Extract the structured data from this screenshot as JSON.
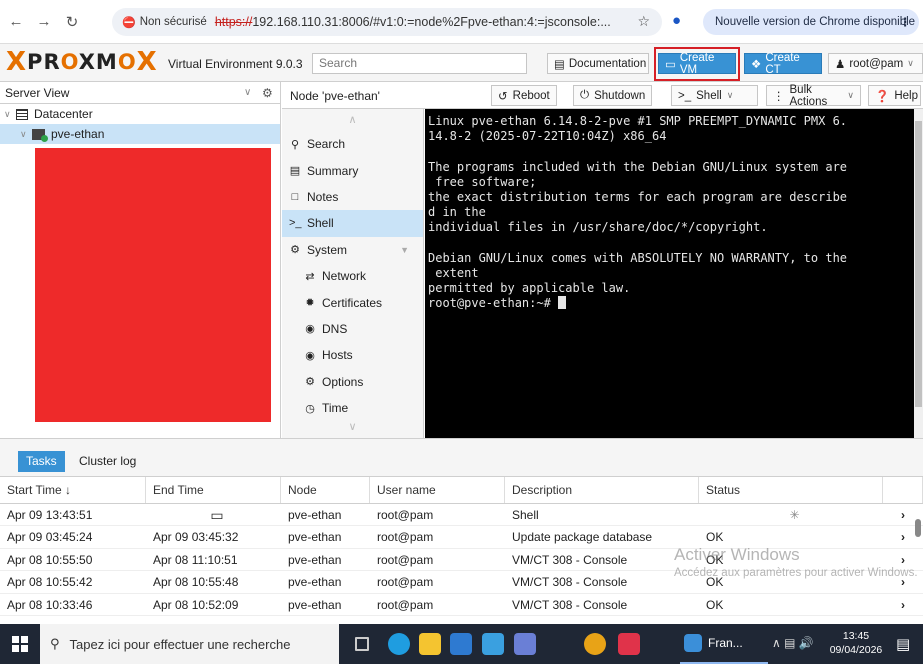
{
  "browser": {
    "security_label": "Non sécurisé",
    "url_scheme": "https://",
    "url_rest": "192.168.110.31:8006/#v1:0:=node%2Fpve-ethan:4:=jsconsole:...",
    "update_label": "Nouvelle version de Chrome disponible"
  },
  "header": {
    "version": "Virtual Environment 9.0.3",
    "search_placeholder": "Search",
    "documentation": "Documentation",
    "create_vm": "Create VM",
    "create_ct": "Create CT",
    "user": "root@pam"
  },
  "tree": {
    "view": "Server View",
    "datacenter": "Datacenter",
    "node": "pve-ethan"
  },
  "node_panel": {
    "title": "Node 'pve-ethan'",
    "reboot": "Reboot",
    "shutdown": "Shutdown",
    "shell": "Shell",
    "bulk": "Bulk Actions",
    "help": "Help",
    "menu": {
      "search": "Search",
      "summary": "Summary",
      "notes": "Notes",
      "shell": "Shell",
      "system": "System",
      "network": "Network",
      "certificates": "Certificates",
      "dns": "DNS",
      "hosts": "Hosts",
      "options": "Options",
      "time": "Time"
    }
  },
  "terminal": {
    "text": "Linux pve-ethan 6.14.8-2-pve #1 SMP PREEMPT_DYNAMIC PMX 6.\n14.8-2 (2025-07-22T10:04Z) x86_64\n\nThe programs included with the Debian GNU/Linux system are\n free software;\nthe exact distribution terms for each program are describe\nd in the\nindividual files in /usr/share/doc/*/copyright.\n\nDebian GNU/Linux comes with ABSOLUTELY NO WARRANTY, to the\n extent\npermitted by applicable law.\nroot@pve-ethan:~# "
  },
  "tasks": {
    "tab_tasks": "Tasks",
    "tab_cluster": "Cluster log",
    "columns": [
      "Start Time ↓",
      "End Time",
      "Node",
      "User name",
      "Description",
      "Status"
    ],
    "rows": [
      {
        "start": "Apr 09 13:43:51",
        "end": "",
        "node": "pve-ethan",
        "user": "root@pam",
        "desc": "Shell",
        "status": ""
      },
      {
        "start": "Apr 09 03:45:24",
        "end": "Apr 09 03:45:32",
        "node": "pve-ethan",
        "user": "root@pam",
        "desc": "Update package database",
        "status": "OK"
      },
      {
        "start": "Apr 08 10:55:50",
        "end": "Apr 08 11:10:51",
        "node": "pve-ethan",
        "user": "root@pam",
        "desc": "VM/CT 308 - Console",
        "status": "OK"
      },
      {
        "start": "Apr 08 10:55:42",
        "end": "Apr 08 10:55:48",
        "node": "pve-ethan",
        "user": "root@pam",
        "desc": "VM/CT 308 - Console",
        "status": "OK"
      },
      {
        "start": "Apr 08 10:33:46",
        "end": "Apr 08 10:52:09",
        "node": "pve-ethan",
        "user": "root@pam",
        "desc": "VM/CT 308 - Console",
        "status": "OK"
      }
    ],
    "watermark_title": "Activer Windows",
    "watermark_sub": "Accédez aux paramètres pour activer Windows."
  },
  "taskbar": {
    "search_placeholder": "Tapez ici pour effectuer une recherche",
    "active_app": "Fran...",
    "time": "13:45",
    "date": "09/04/2026"
  }
}
